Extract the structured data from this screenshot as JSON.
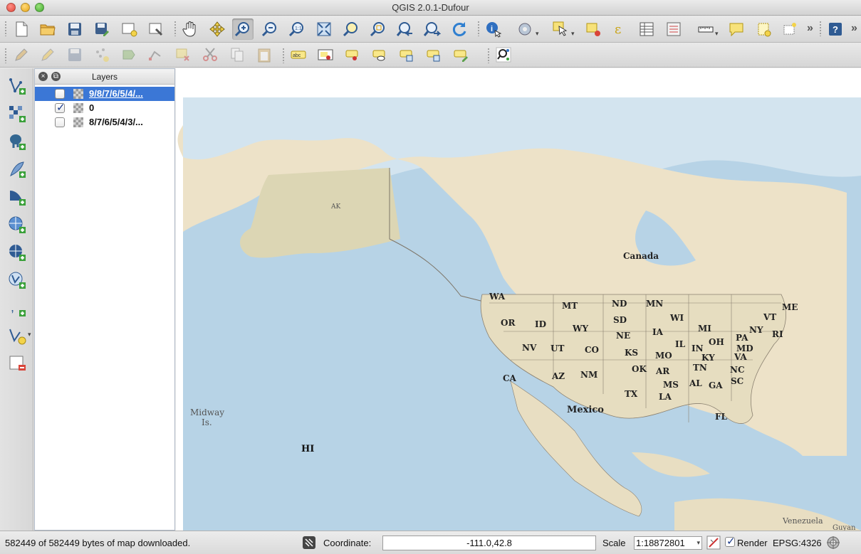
{
  "window": {
    "title": "QGIS 2.0.1-Dufour"
  },
  "toolbar1": {
    "buttons": [
      "new-project",
      "open-project",
      "save-project",
      "save-as",
      "new-print-composer",
      "composer-manager",
      "pan",
      "pan-to-selection",
      "zoom-in",
      "zoom-out",
      "zoom-actual-size",
      "zoom-full",
      "zoom-to-layer",
      "zoom-to-selection",
      "zoom-last",
      "zoom-next",
      "refresh",
      "identify",
      "run-action",
      "select-features",
      "deselect-all",
      "expression",
      "attribute-table",
      "statistics",
      "measure",
      "map-tips",
      "new-bookmark",
      "show-bookmarks",
      "help"
    ],
    "overflow_label": "»",
    "dropdown_label": "▾"
  },
  "toolbar2": {
    "labeling_text": "abc"
  },
  "layers_panel": {
    "title": "Layers",
    "close_label": "×",
    "float_label": "⧉",
    "items": [
      {
        "label": "9/8/7/6/5/4/...",
        "checked": false,
        "selected": true
      },
      {
        "label": "0",
        "checked": true,
        "selected": false
      },
      {
        "label": "8/7/6/5/4/3/...",
        "checked": false,
        "selected": false
      }
    ],
    "check_mark": "✓"
  },
  "map": {
    "labels": {
      "canada": "Canada",
      "ak": "AK",
      "mexico": "Mexico",
      "hi": "HI",
      "midway": "Midway",
      "midway2": "Is.",
      "venezuela": "Venezuela",
      "guyana": "Guyan"
    },
    "states": [
      "WA",
      "OR",
      "CA",
      "ID",
      "NV",
      "MT",
      "WY",
      "UT",
      "AZ",
      "CO",
      "NM",
      "ND",
      "SD",
      "NE",
      "KS",
      "OK",
      "TX",
      "MN",
      "IA",
      "MO",
      "AR",
      "LA",
      "WI",
      "IL",
      "MI",
      "IN",
      "KY",
      "TN",
      "MS",
      "AL",
      "GA",
      "FL",
      "OH",
      "SC",
      "NC",
      "VA",
      "PA",
      "NY",
      "MD",
      "VT",
      "ME",
      "RI"
    ],
    "colors": {
      "ocean": "#b7d3e6",
      "deep_ocean": "#a9c8df",
      "land": "#ede2c8",
      "ice": "#eef4f7",
      "border": "#7d7568"
    }
  },
  "statusbar": {
    "message": "582449 of 582449 bytes of map downloaded.",
    "coordinate_label": "Coordinate:",
    "coordinate_value": "-111.0,42.8",
    "scale_label": "Scale",
    "scale_value": "1:18872801",
    "scale_arrow": "▾",
    "render_label": "Render",
    "render_checked": true,
    "crs": "EPSG:4326"
  }
}
